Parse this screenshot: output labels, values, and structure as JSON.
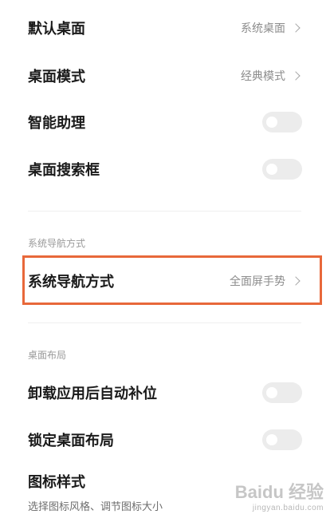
{
  "settings": {
    "rows": [
      {
        "label": "默认桌面",
        "value": "系统桌面",
        "type": "link"
      },
      {
        "label": "桌面模式",
        "value": "经典模式",
        "type": "link"
      },
      {
        "label": "智能助理",
        "type": "toggle",
        "on": false
      },
      {
        "label": "桌面搜索框",
        "type": "toggle",
        "on": false
      }
    ],
    "nav_section": {
      "title": "系统导航方式",
      "row": {
        "label": "系统导航方式",
        "value": "全面屏手势",
        "type": "link"
      }
    },
    "layout_section": {
      "title": "桌面布局",
      "rows": [
        {
          "label": "卸载应用后自动补位",
          "type": "toggle",
          "on": false
        },
        {
          "label": "锁定桌面布局",
          "type": "toggle",
          "on": false
        },
        {
          "label": "图标样式",
          "subtitle": "选择图标风格、调节图标大小",
          "type": "link"
        }
      ]
    }
  },
  "watermark": {
    "brand": "Baidu 经验",
    "url": "jingyan.baidu.com"
  },
  "colors": {
    "highlight": "#e8683a",
    "toggle_off": "#ececec"
  }
}
